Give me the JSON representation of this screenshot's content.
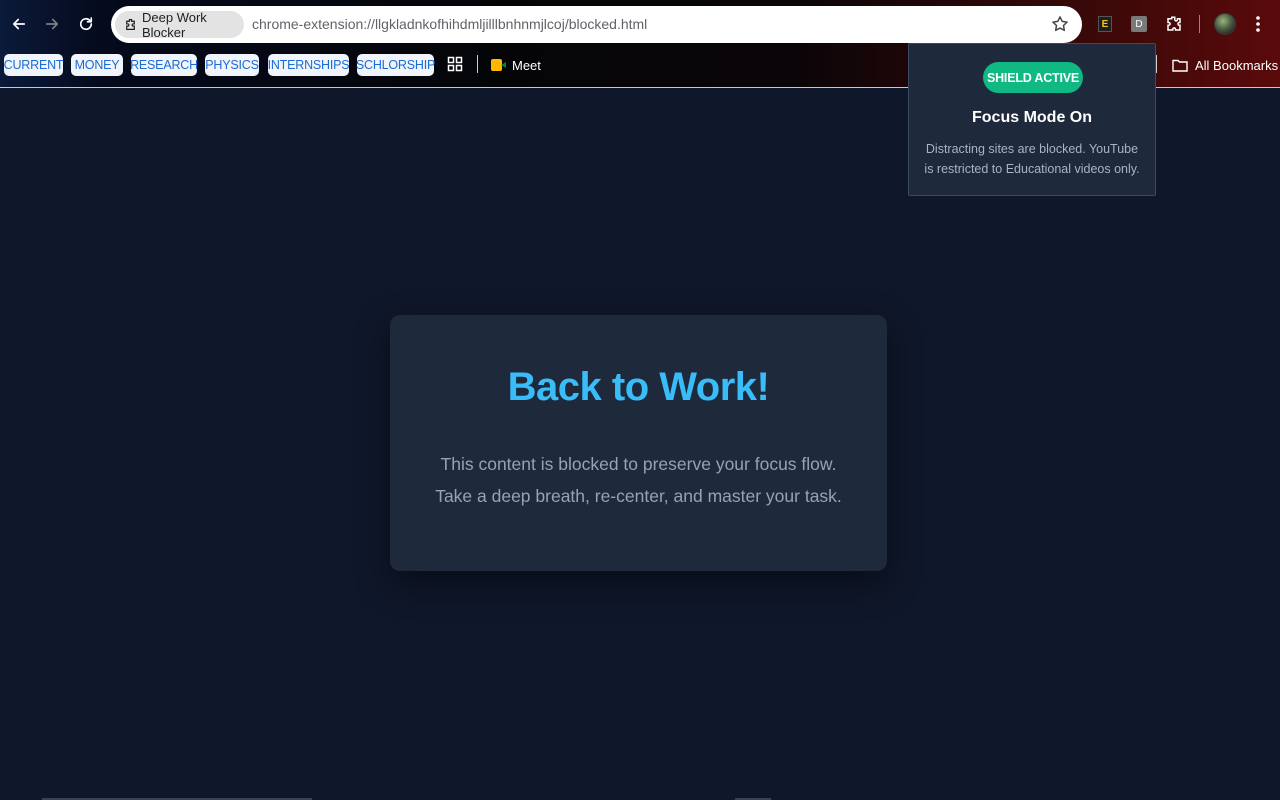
{
  "browser": {
    "site_chip_label": "Deep Work Blocker",
    "url": "chrome-extension://llgkladnkofhihdmljilllbnhnmjlcoj/blocked.html",
    "extensions": [
      {
        "name": "E",
        "icon": "extension-e-icon"
      },
      {
        "name": "D",
        "icon": "extension-d-icon"
      }
    ]
  },
  "bookmarks": {
    "items": [
      {
        "label": "CURRENT"
      },
      {
        "label": "MONEY"
      },
      {
        "label": "RESEARCH"
      },
      {
        "label": "PHYSICS"
      },
      {
        "label": "INTERNSHIPS"
      },
      {
        "label": "SCHLORSHIP"
      }
    ],
    "meet_label": "Meet",
    "all_bookmarks_label": "All Bookmarks"
  },
  "popup": {
    "badge": "SHIELD ACTIVE",
    "title": "Focus Mode On",
    "text": "Distracting sites are blocked. YouTube is restricted to Educational videos only."
  },
  "card": {
    "title": "Back to Work!",
    "text": "This content is blocked to preserve your focus flow. Take a deep breath, re-center, and master your task."
  },
  "colors": {
    "page_bg": "#0f172a",
    "card_bg": "#1e293b",
    "accent": "#38bdf8",
    "badge": "#10b981",
    "bookmark_text": "#1a6bd6"
  }
}
